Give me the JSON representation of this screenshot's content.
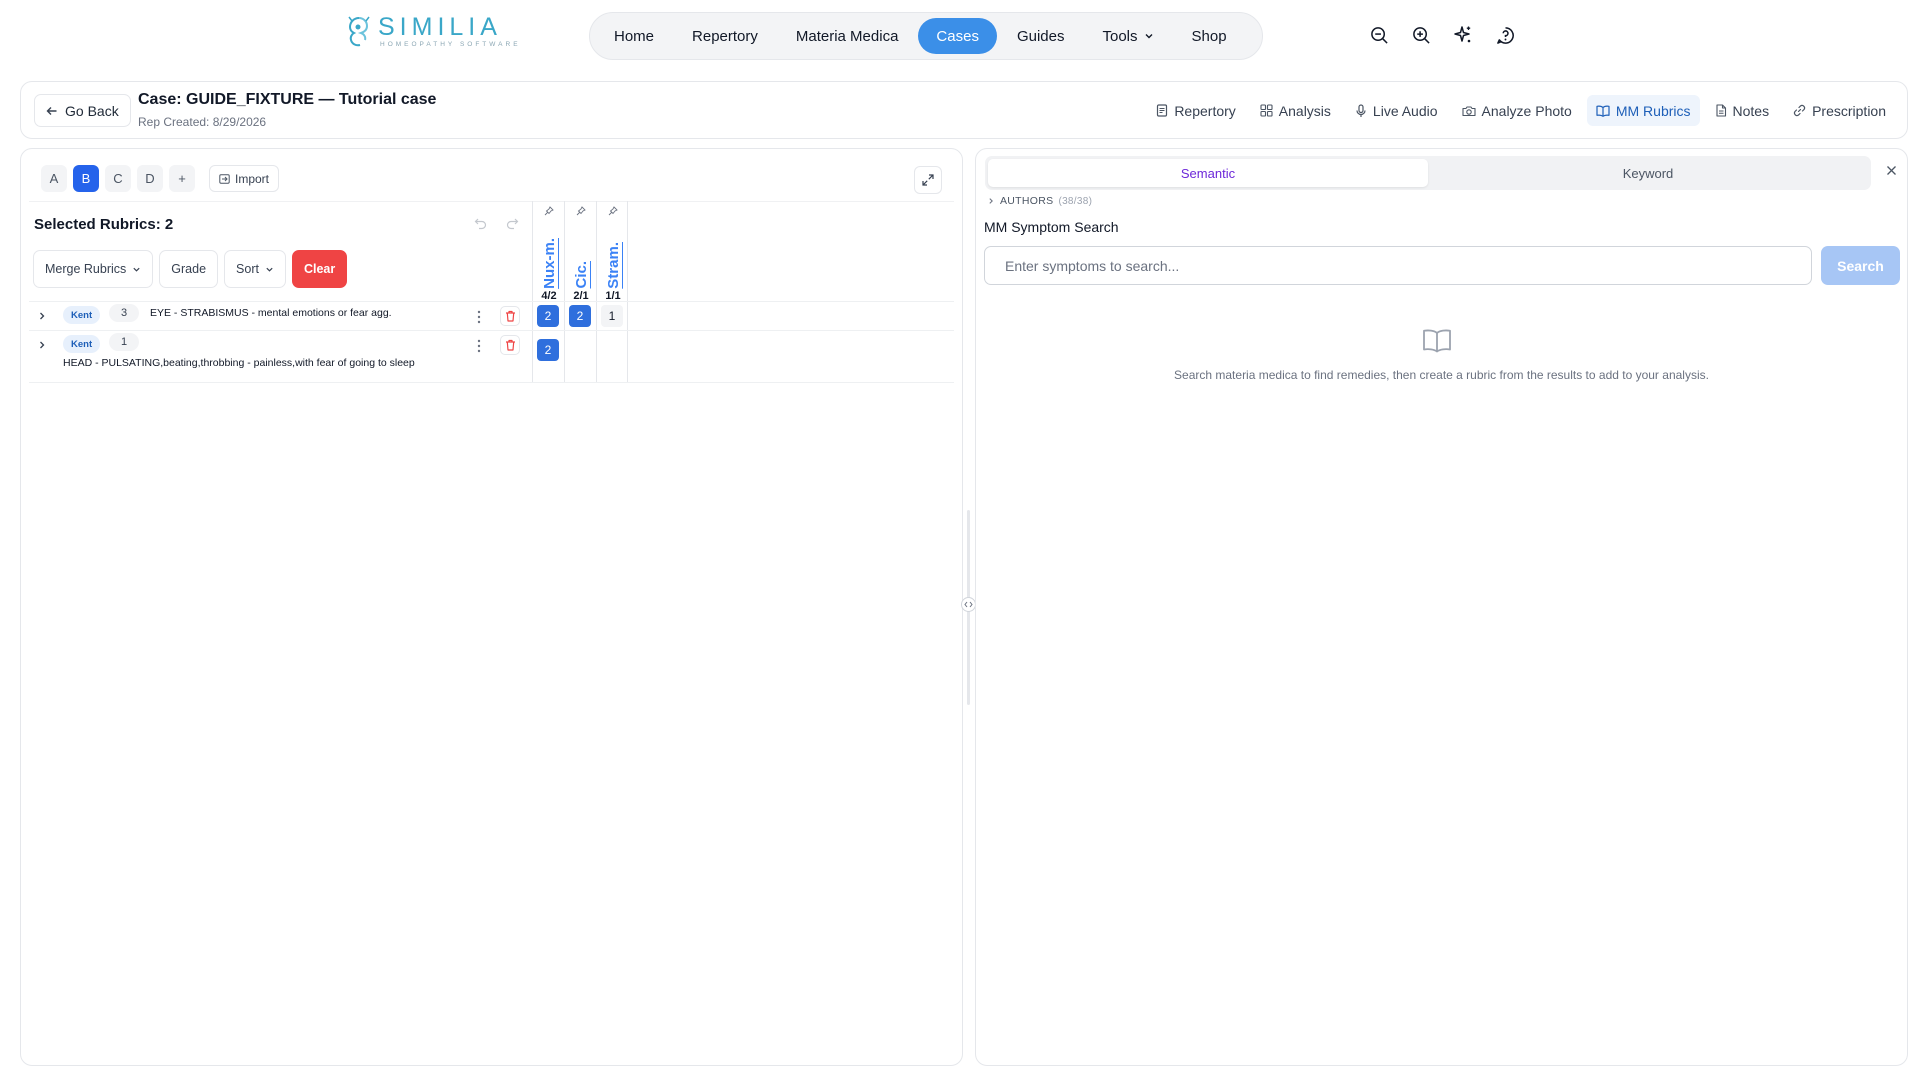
{
  "brand": {
    "name": "SIMILIA",
    "tagline": "HOMEOPATHY SOFTWARE",
    "accent": "#3aa7c8",
    "primary": "#3b8fe8"
  },
  "nav": {
    "items": [
      {
        "label": "Home"
      },
      {
        "label": "Repertory"
      },
      {
        "label": "Materia Medica"
      },
      {
        "label": "Cases",
        "active": true
      },
      {
        "label": "Guides"
      },
      {
        "label": "Tools",
        "dropdown": true
      },
      {
        "label": "Shop"
      }
    ],
    "icons": [
      "zoom-out-icon",
      "zoom-in-icon",
      "sparkles-icon",
      "help-circle-icon"
    ]
  },
  "case": {
    "back_label": "Go Back",
    "title": "Case: GUIDE_FIXTURE — Tutorial case",
    "created": "Rep Created: 8/29/2026",
    "tabs": [
      {
        "label": "Repertory",
        "icon": "document-icon"
      },
      {
        "label": "Analysis",
        "icon": "grid-icon"
      },
      {
        "label": "Live Audio",
        "icon": "microphone-icon"
      },
      {
        "label": "Analyze Photo",
        "icon": "camera-icon"
      },
      {
        "label": "MM Rubrics",
        "icon": "book-icon",
        "active": true
      },
      {
        "label": "Notes",
        "icon": "note-icon"
      },
      {
        "label": "Prescription",
        "icon": "link-icon"
      }
    ]
  },
  "analysis": {
    "sheets": [
      {
        "label": "A"
      },
      {
        "label": "B",
        "active": true
      },
      {
        "label": "C"
      },
      {
        "label": "D"
      },
      {
        "label": "+"
      }
    ],
    "import_label": "Import",
    "selected_title": "Selected Rubrics: 2",
    "tools": {
      "merge": "Merge Rubrics",
      "grade": "Grade",
      "sort": "Sort",
      "clear": "Clear"
    },
    "remedies": [
      {
        "name": "Nux-m.",
        "score": "4/2"
      },
      {
        "name": "Cic.",
        "score": "2/1"
      },
      {
        "name": "Stram.",
        "score": "1/1"
      }
    ],
    "rubrics": [
      {
        "source": "Kent",
        "grade": "3",
        "text": "EYE - STRABISMUS - mental emotions or fear agg.",
        "cells": [
          "2",
          "2",
          "1"
        ]
      },
      {
        "source": "Kent",
        "grade": "1",
        "text": "HEAD - PULSATING,beating,throbbing - painless,with fear of going to sleep",
        "cells": [
          "2",
          "",
          ""
        ]
      }
    ]
  },
  "mm": {
    "modes": [
      {
        "label": "Semantic",
        "active": true
      },
      {
        "label": "Keyword"
      }
    ],
    "authors_label": "AUTHORS",
    "authors_count": "(38/38)",
    "title": "MM Symptom Search",
    "search_placeholder": "Enter symptoms to search...",
    "search_button": "Search",
    "empty_text": "Search materia medica to find remedies, then create a rubric from the results to add to your analysis."
  }
}
